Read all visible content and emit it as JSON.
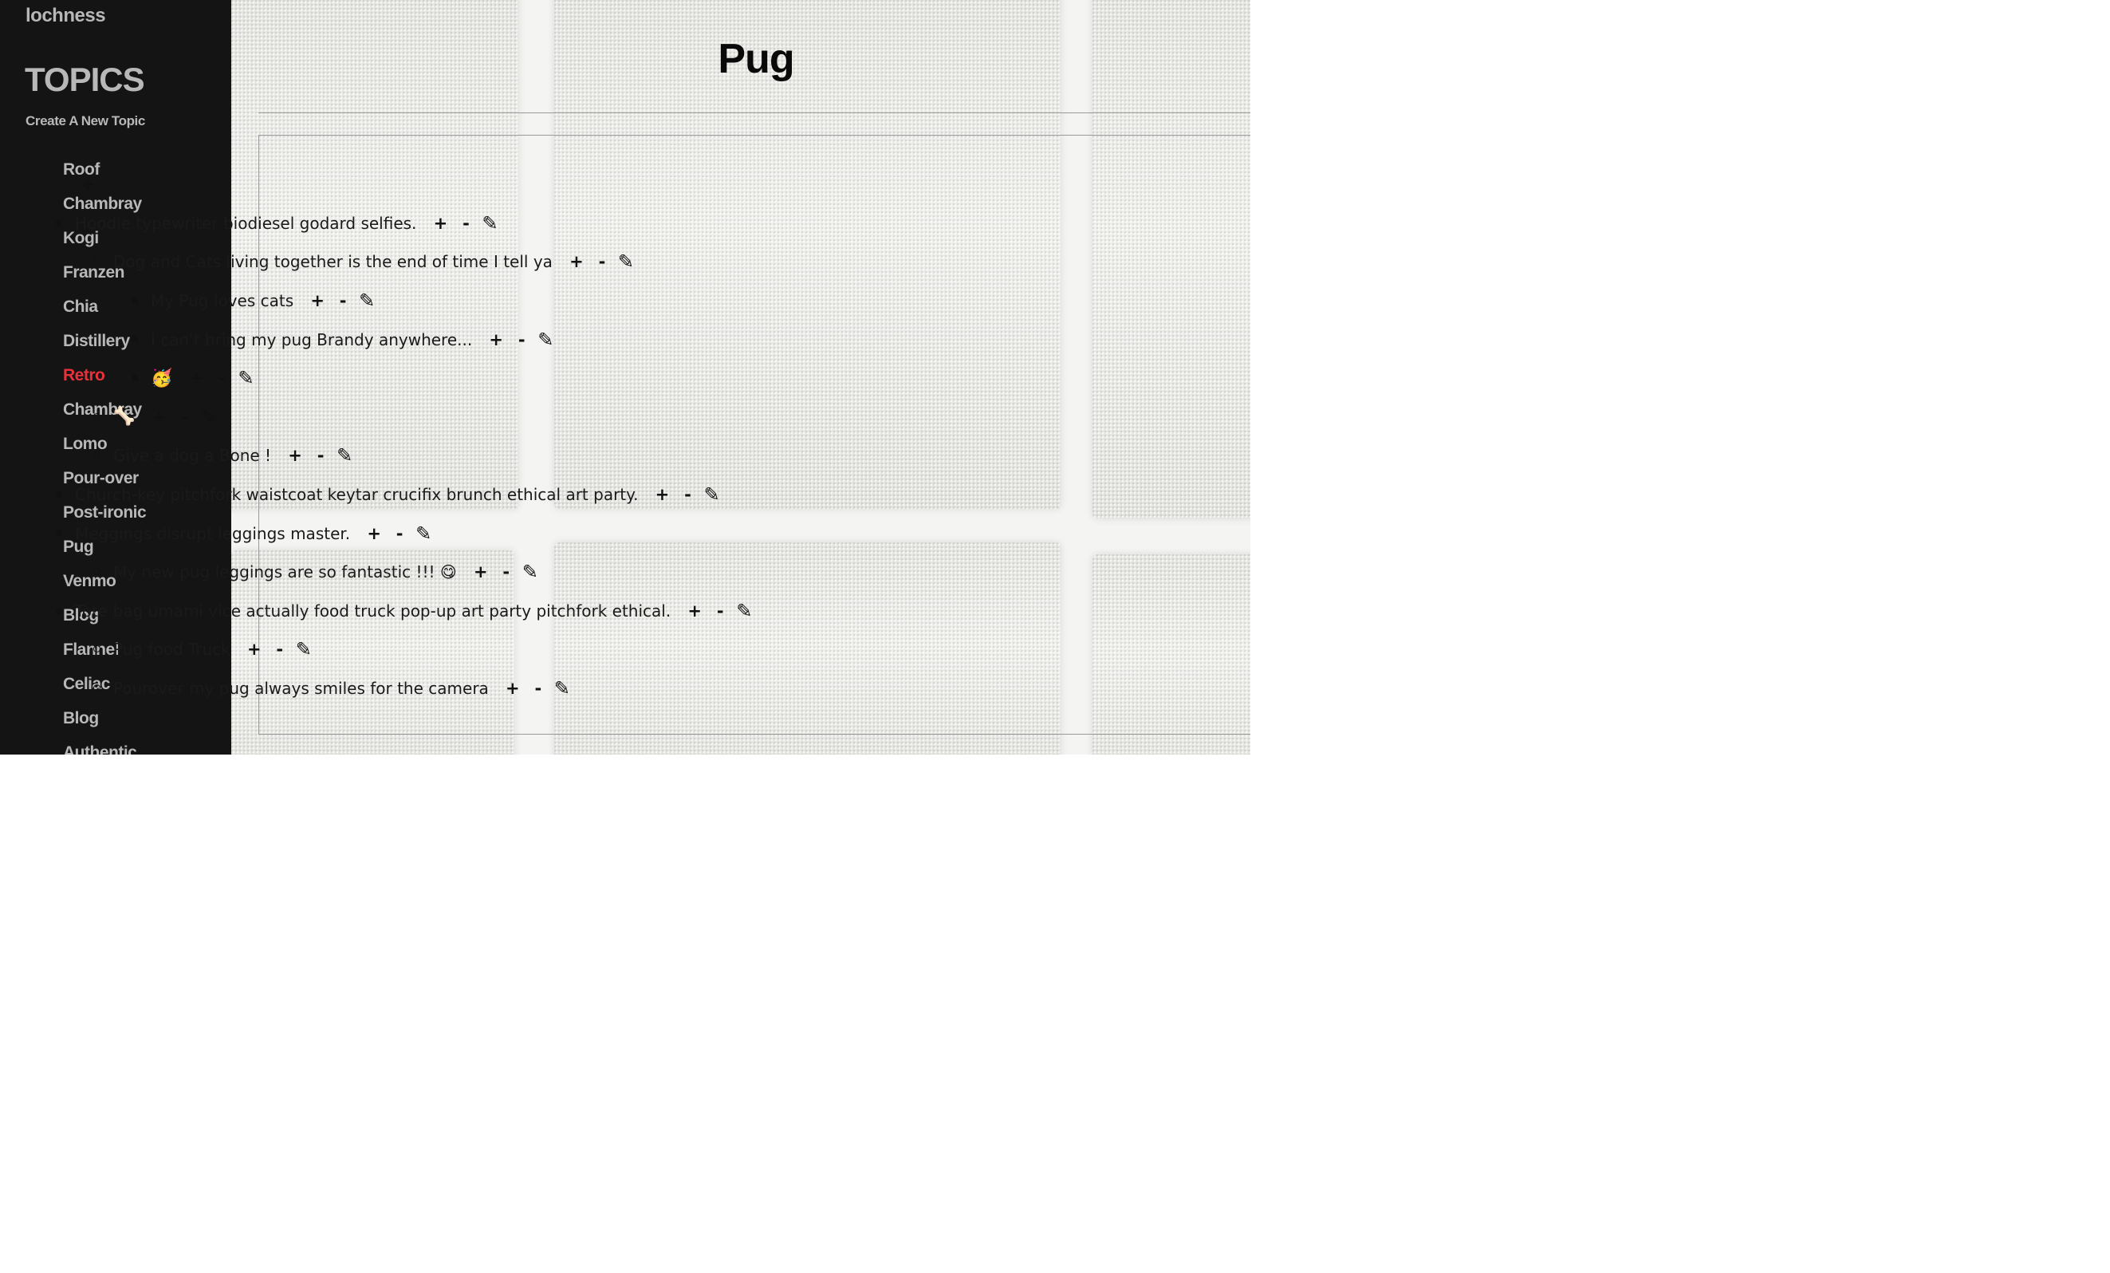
{
  "app": {
    "title": "lochness"
  },
  "sidebar": {
    "heading": "TOPICS",
    "create_label": "Create A New Topic",
    "active_color": "#e8313b",
    "topics": [
      {
        "label": "Roof",
        "active": false
      },
      {
        "label": "Chambray",
        "active": false
      },
      {
        "label": "Kogi",
        "active": false
      },
      {
        "label": "Franzen",
        "active": false
      },
      {
        "label": "Chia",
        "active": false
      },
      {
        "label": "Distillery",
        "active": false
      },
      {
        "label": "Retro",
        "active": true
      },
      {
        "label": "Chambray",
        "active": false
      },
      {
        "label": "Lomo",
        "active": false
      },
      {
        "label": "Pour-over",
        "active": false
      },
      {
        "label": "Post-ironic",
        "active": false
      },
      {
        "label": "Pug",
        "active": false
      },
      {
        "label": "Venmo",
        "active": false
      },
      {
        "label": "Blog",
        "active": false
      },
      {
        "label": "Flannel",
        "active": false
      },
      {
        "label": "Celiac",
        "active": false
      },
      {
        "label": "Blog",
        "active": false
      },
      {
        "label": "Authentic",
        "active": false
      }
    ]
  },
  "page": {
    "title": "Pug",
    "root_add": "+"
  },
  "actions": {
    "add": "+",
    "remove": "-",
    "edit": "✎"
  },
  "tree": [
    {
      "text": "Hoodie typewriter biodiesel godard selfies.",
      "children": [
        {
          "text": "Dog and Cats living together is the end of time I tell ya",
          "children": [
            {
              "text": "My Pug loves cats"
            },
            {
              "text": "I can't bring my pug Brandy anywhere..."
            },
            {
              "text": "🥳"
            }
          ]
        },
        {
          "text": "🦴"
        },
        {
          "text": "Give a dog a Bone !"
        }
      ]
    },
    {
      "text": "Church-key pitchfork waistcoat keytar crucifix brunch ethical art party."
    },
    {
      "text": "Meggings disrupt leggings master.",
      "children": [
        {
          "text": "My new pug leggings are so fantastic !!! 😋"
        }
      ]
    },
    {
      "text": "Tote bag umami vice actually food truck pop-up art party pitchfork ethical.",
      "children": [
        {
          "text": "Pug food Truck"
        },
        {
          "text": "Pourover my pug always smiles for the camera"
        }
      ]
    }
  ]
}
